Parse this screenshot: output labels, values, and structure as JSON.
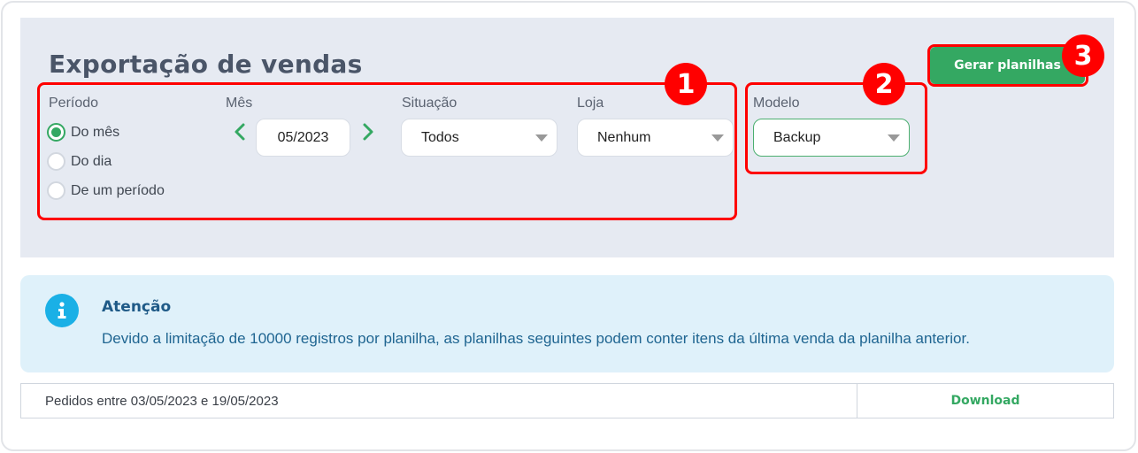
{
  "page": {
    "title": "Exportação de vendas"
  },
  "filters": {
    "period": {
      "label": "Período",
      "options": [
        {
          "label": "Do mês",
          "checked": true
        },
        {
          "label": "Do dia",
          "checked": false
        },
        {
          "label": "De um período",
          "checked": false
        }
      ]
    },
    "month": {
      "label": "Mês",
      "value": "05/2023",
      "prev_icon": "chevron-left-icon",
      "next_icon": "chevron-right-icon"
    },
    "status": {
      "label": "Situação",
      "value": "Todos"
    },
    "store": {
      "label": "Loja",
      "value": "Nenhum"
    },
    "model": {
      "label": "Modelo",
      "value": "Backup"
    }
  },
  "actions": {
    "generate_label": "Gerar planilhas"
  },
  "annotations": [
    "1",
    "2",
    "3"
  ],
  "alert": {
    "icon": "info-icon",
    "title": "Atenção",
    "message": "Devido a limitação de 10000 registros por planilha, as planilhas seguintes podem conter itens da última venda da planilha anterior."
  },
  "results": [
    {
      "label": "Pedidos entre 03/05/2023 e 19/05/2023",
      "action": "Download"
    }
  ],
  "colors": {
    "accent": "#34a862",
    "annotation": "#ff0000",
    "panel": "#e6eaf2",
    "alert_bg": "#dff1fa"
  }
}
